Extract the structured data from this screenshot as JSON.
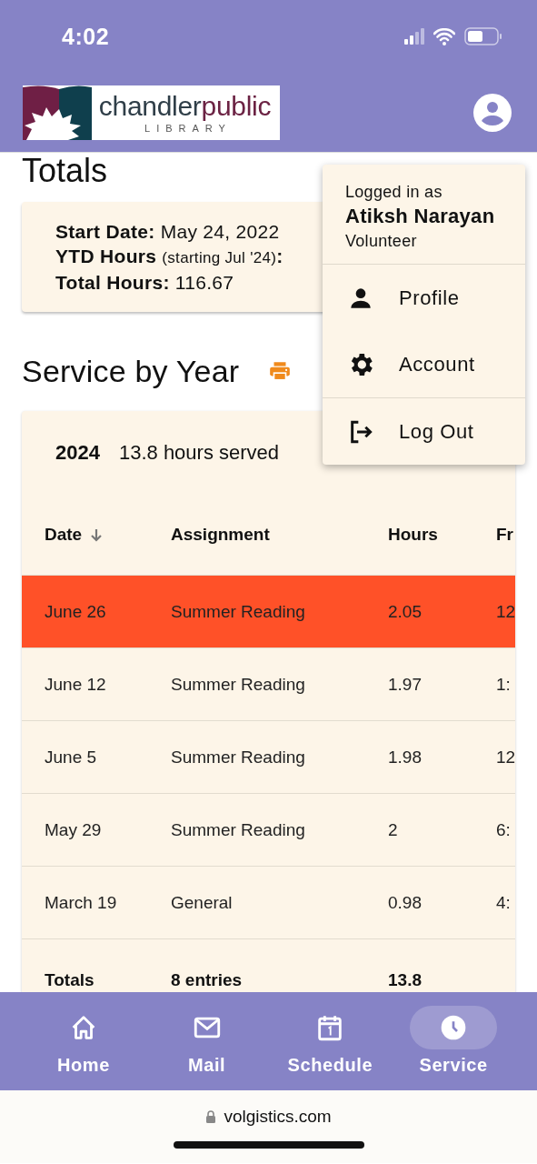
{
  "status_bar": {
    "time": "4:02"
  },
  "header": {
    "logo": {
      "word_1": "chandler",
      "word_2": "public",
      "subtitle": "LIBRARY"
    }
  },
  "totals": {
    "heading": "Totals",
    "lines": [
      {
        "label": "Start Date:",
        "value": "May 24, 2022"
      },
      {
        "label": "YTD Hours",
        "note": "(starting Jul '24)",
        "suffix": ":"
      },
      {
        "label": "Total Hours:",
        "value": "116.67"
      }
    ]
  },
  "service": {
    "heading": "Service by Year",
    "year": "2024",
    "summary": "13.8 hours served",
    "columns": [
      {
        "label": "Date",
        "sorted_descending": true
      },
      {
        "label": "Assignment"
      },
      {
        "label": "Hours"
      },
      {
        "label": "Fr"
      }
    ],
    "rows": [
      {
        "cells": [
          "June 26",
          "Summer Reading",
          "2.05",
          "12"
        ],
        "highlighted": true
      },
      {
        "cells": [
          "June 12",
          "Summer Reading",
          "1.97",
          "1:"
        ],
        "highlighted": false
      },
      {
        "cells": [
          "June 5",
          "Summer Reading",
          "1.98",
          "12"
        ],
        "highlighted": false
      },
      {
        "cells": [
          "May 29",
          "Summer Reading",
          "2",
          "6:"
        ],
        "highlighted": false
      },
      {
        "cells": [
          "March 19",
          "General",
          "0.98",
          "4:"
        ],
        "highlighted": false
      }
    ],
    "totals_row": [
      "Totals",
      "8 entries",
      "13.8"
    ]
  },
  "user_menu": {
    "caption": "Logged in as",
    "name": "Atiksh Narayan",
    "role": "Volunteer",
    "groups": [
      [
        {
          "label": "Profile",
          "kind": "person"
        },
        {
          "label": "Account",
          "kind": "gear"
        }
      ],
      [
        {
          "label": "Log Out",
          "kind": "logout"
        }
      ]
    ]
  },
  "bottom_nav": [
    {
      "label": "Home",
      "kind": "home",
      "selected": false
    },
    {
      "label": "Mail",
      "kind": "mail",
      "selected": false
    },
    {
      "label": "Schedule",
      "kind": "calendar",
      "selected": false
    },
    {
      "label": "Service",
      "kind": "clock",
      "selected": true
    }
  ],
  "address_bar": {
    "url": "volgistics.com"
  }
}
